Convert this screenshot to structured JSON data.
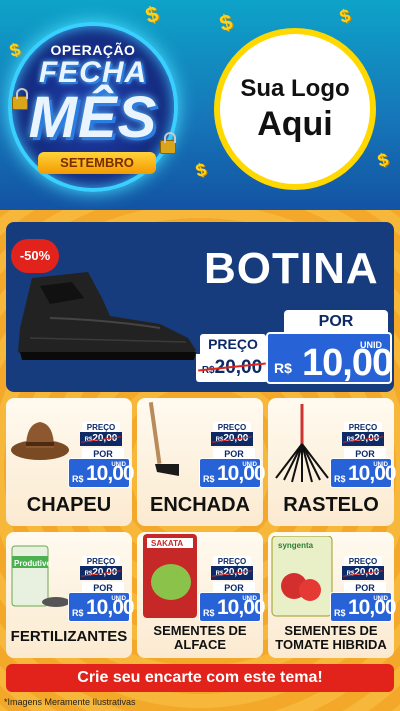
{
  "campaign": {
    "top": "OPERAÇÃO",
    "line1": "FECHA",
    "line2": "MÊS",
    "month": "SETEMBRO"
  },
  "logo": {
    "line1": "Sua Logo",
    "line2": "Aqui"
  },
  "hero": {
    "discount": "-50%",
    "title": "BOTINA",
    "price_label": "PREÇO",
    "old_currency": "R$",
    "old_price": "20,00",
    "por_label": "POR",
    "currency": "R$",
    "price": "10,00",
    "unit": "UNID"
  },
  "products": [
    {
      "name": "CHAPEU",
      "price_label": "PREÇO",
      "old_currency": "R$",
      "old_price": "20,00",
      "por": "POR",
      "currency": "R$",
      "price": "10,00",
      "unit": "UNID"
    },
    {
      "name": "ENCHADA",
      "price_label": "PREÇO",
      "old_currency": "R$",
      "old_price": "20,00",
      "por": "POR",
      "currency": "R$",
      "price": "10,00",
      "unit": "UNID"
    },
    {
      "name": "RASTELO",
      "price_label": "PREÇO",
      "old_currency": "R$",
      "old_price": "20,00",
      "por": "POR",
      "currency": "R$",
      "price": "10,00",
      "unit": "UNID"
    },
    {
      "name": "FERTILIZANTES",
      "price_label": "PREÇO",
      "old_currency": "R$",
      "old_price": "20,00",
      "por": "POR",
      "currency": "R$",
      "price": "10,00",
      "unit": "UNID",
      "pack_text": "Produtive"
    },
    {
      "name": "SEMENTES DE\nALFACE",
      "price_label": "PREÇO",
      "old_currency": "R$",
      "old_price": "20,00",
      "por": "POR",
      "currency": "R$",
      "price": "10,00",
      "unit": "UNID",
      "pack_text": "SAKATA"
    },
    {
      "name": "SEMENTES DE\nTOMATE HIBRIDA",
      "price_label": "PREÇO",
      "old_currency": "R$",
      "old_price": "20,00",
      "por": "POR",
      "currency": "R$",
      "price": "10,00",
      "unit": "UNID",
      "pack_text": "syngenta"
    }
  ],
  "cta": "Crie seu encarte com este tema!",
  "footnote": "*Imagens Meramente Ilustrativas",
  "colors": {
    "red": "#e1231b",
    "navy": "#173c7d",
    "blue": "#2763d6",
    "orange": "#f6b73a",
    "yellow": "#ffd800"
  }
}
